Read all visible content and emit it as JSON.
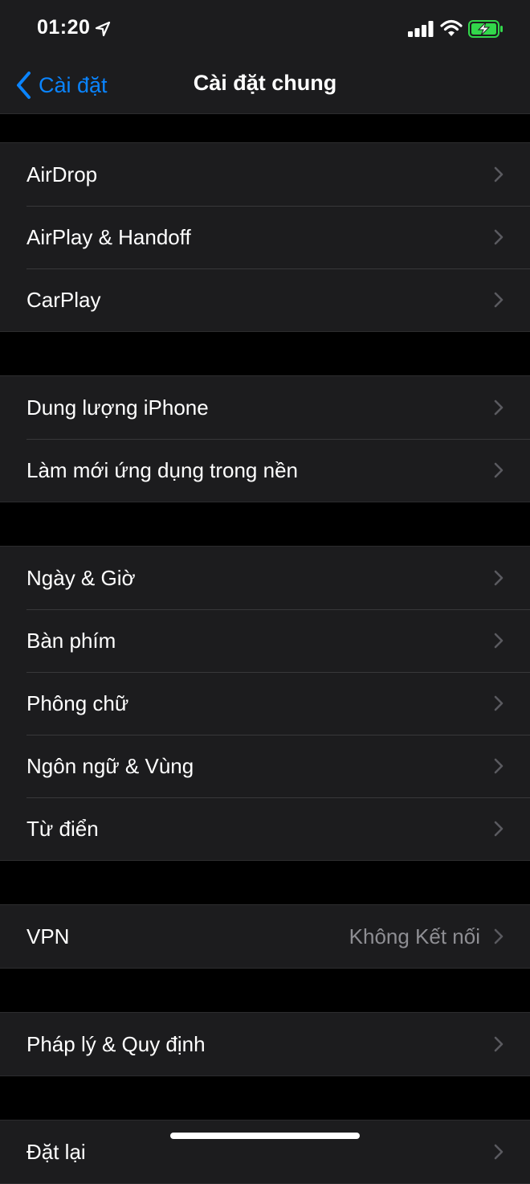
{
  "status_bar": {
    "time": "01:20",
    "icons": [
      "location-arrow-icon",
      "cellular-signal-icon",
      "wifi-icon",
      "battery-charging-icon"
    ],
    "battery_color": "#32d74b"
  },
  "nav": {
    "back_label": "Cài đặt",
    "title": "Cài đặt chung",
    "accent_color": "#0a84ff"
  },
  "groups": [
    {
      "items": [
        {
          "label": "AirDrop"
        },
        {
          "label": "AirPlay & Handoff"
        },
        {
          "label": "CarPlay"
        }
      ]
    },
    {
      "items": [
        {
          "label": "Dung lượng iPhone"
        },
        {
          "label": "Làm mới ứng dụng trong nền"
        }
      ]
    },
    {
      "items": [
        {
          "label": "Ngày & Giờ"
        },
        {
          "label": "Bàn phím"
        },
        {
          "label": "Phông chữ"
        },
        {
          "label": "Ngôn ngữ & Vùng"
        },
        {
          "label": "Từ điển"
        }
      ]
    },
    {
      "items": [
        {
          "label": "VPN",
          "value": "Không Kết nối"
        }
      ]
    },
    {
      "items": [
        {
          "label": "Pháp lý & Quy định"
        }
      ]
    },
    {
      "items": [
        {
          "label": "Đặt lại"
        }
      ]
    }
  ]
}
